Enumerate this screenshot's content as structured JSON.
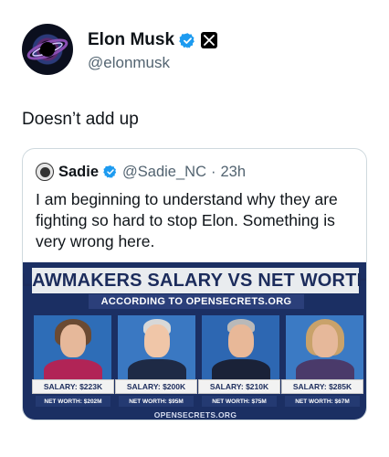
{
  "author": {
    "display_name": "Elon Musk",
    "handle": "@elonmusk",
    "avatar_icon": "galaxy-avatar-icon",
    "verified_icon": "verified-badge-icon",
    "affiliation_icon": "x-logo-icon",
    "badge_color": "#1d9bf0"
  },
  "tweet": {
    "text": "Doesn’t add up"
  },
  "quote": {
    "name": "Sadie",
    "handle": "@Sadie_NC",
    "separator": "·",
    "time": "23h",
    "text": "I am beginning to understand why they are fighting so hard to stop Elon. Something is very wrong here.",
    "media": {
      "title": "LAWMAKERS SALARY VS NET WORTH",
      "subtitle": "ACCORDING TO OPENSECRETS.ORG",
      "footer": "OPENSECRETS.ORG",
      "panels": [
        {
          "salary": "SALARY: $223K",
          "net_worth": "NET WORTH: $202M"
        },
        {
          "salary": "SALARY: $200K",
          "net_worth": "NET WORTH: $95M"
        },
        {
          "salary": "SALARY: $210K",
          "net_worth": "NET WORTH: $75M"
        },
        {
          "salary": "SALARY: $285K",
          "net_worth": "NET WORTH: $67M"
        }
      ]
    }
  }
}
